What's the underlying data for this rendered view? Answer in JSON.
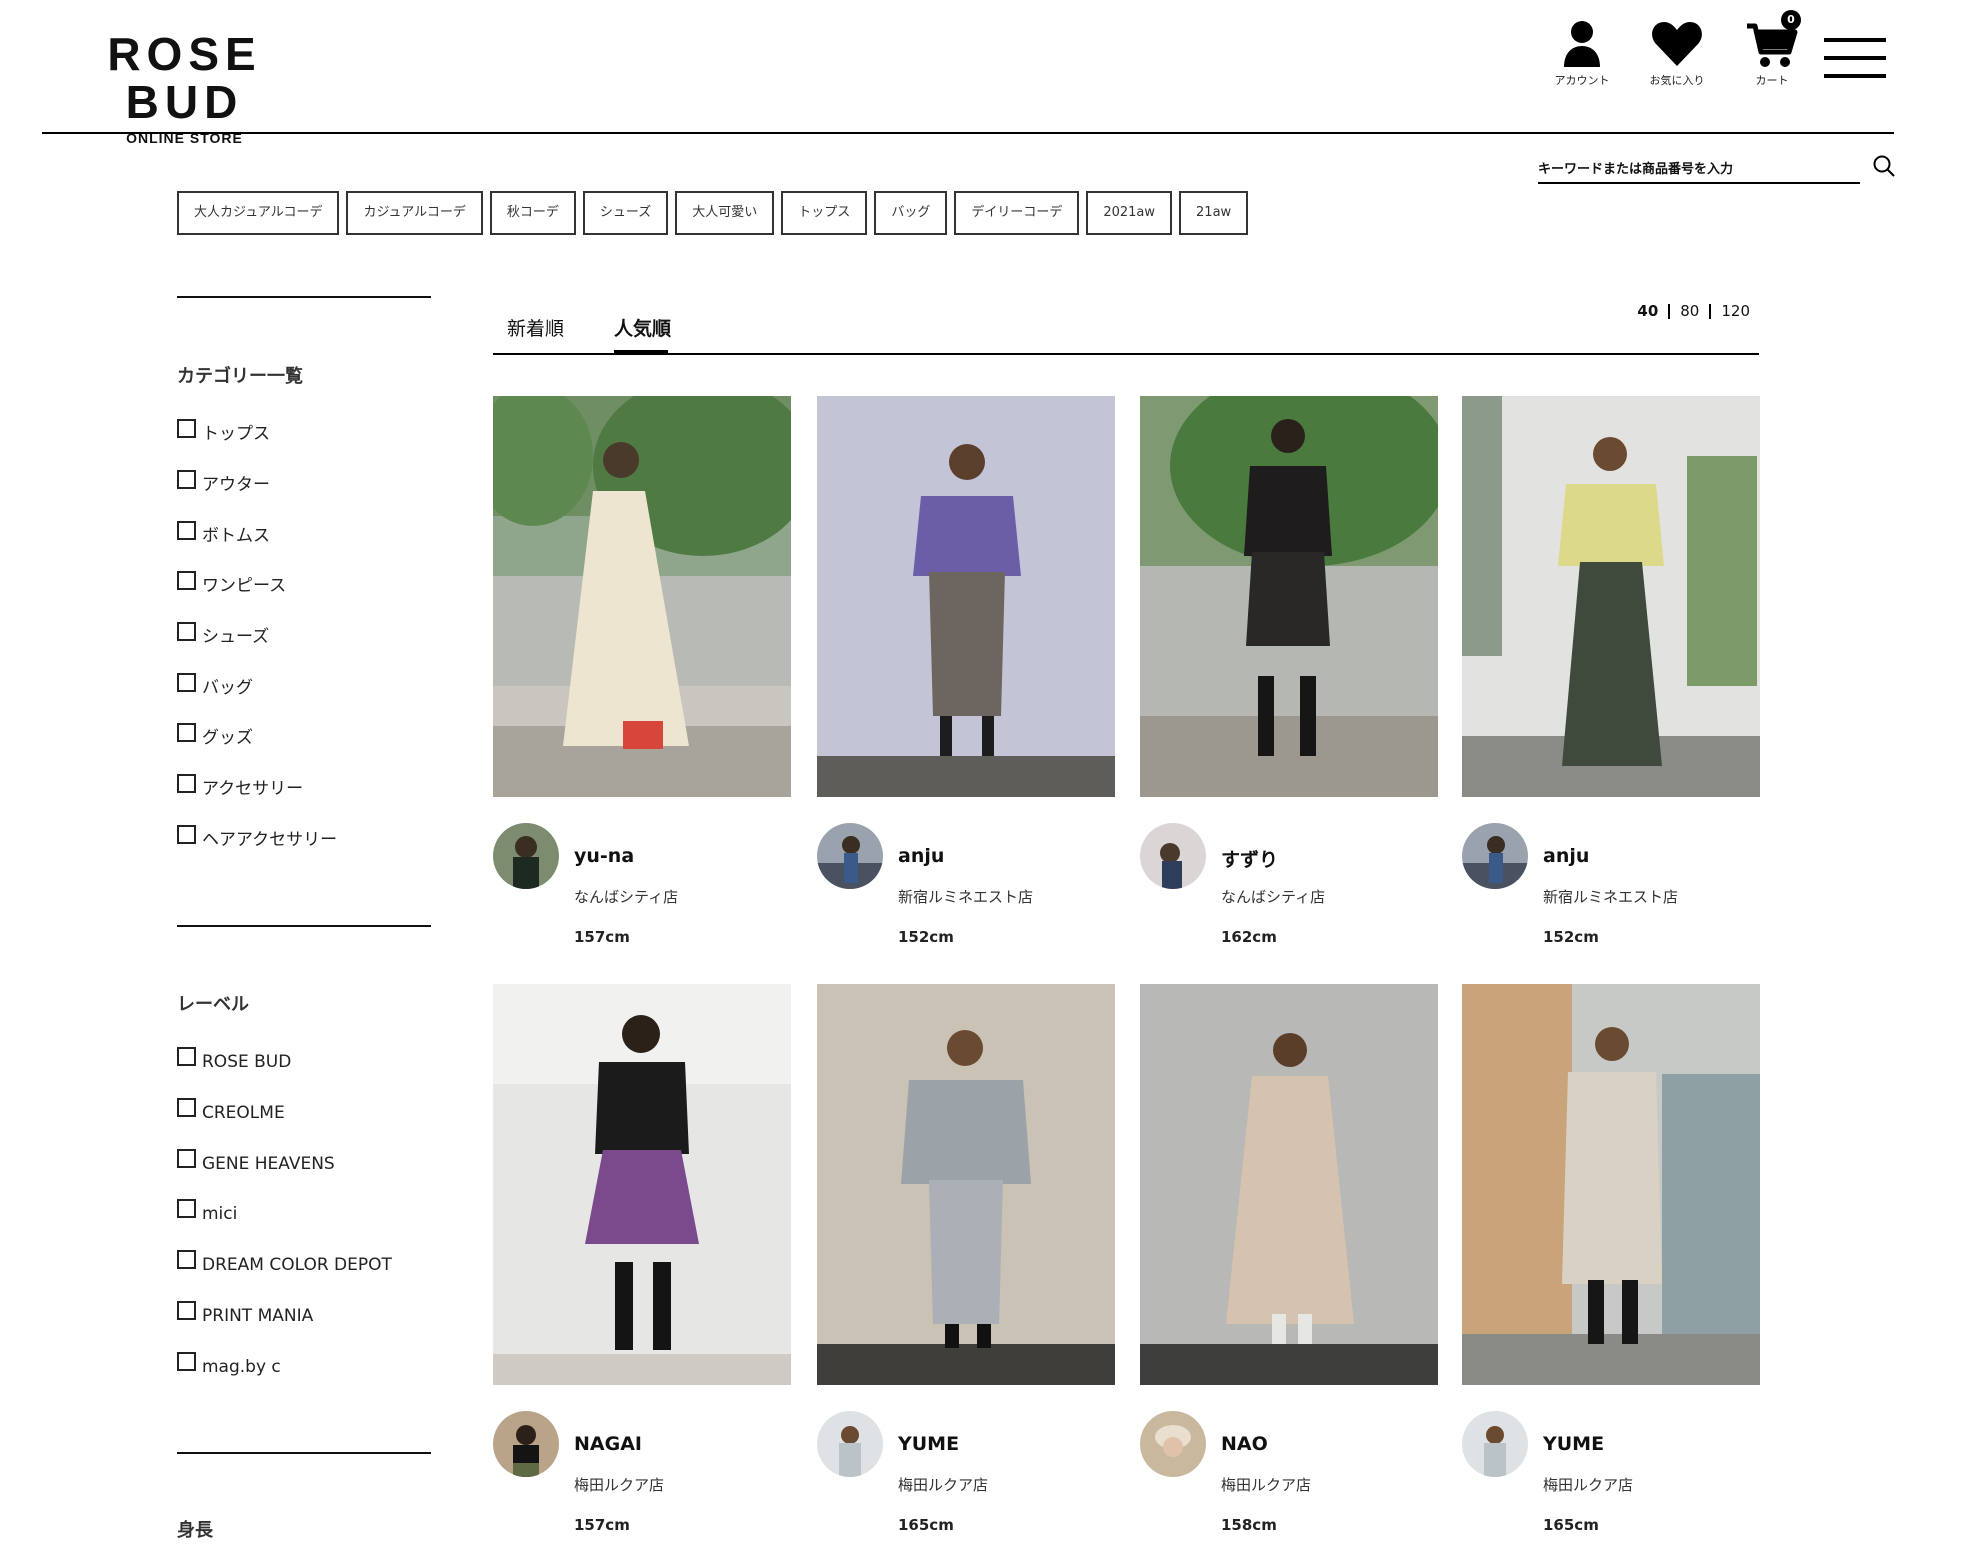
{
  "header": {
    "logo_main": "ROSE BUD",
    "logo_sub": "ONLINE STORE",
    "account_label": "アカウント",
    "favorite_label": "お気に入り",
    "cart_label": "カート",
    "cart_count": "0"
  },
  "search": {
    "placeholder": "キーワードまたは商品番号を入力"
  },
  "tags": [
    "大人カジュアルコーデ",
    "カジュアルコーデ",
    "秋コーデ",
    "シューズ",
    "大人可愛い",
    "トップス",
    "バッグ",
    "デイリーコーデ",
    "2021aw",
    "21aw"
  ],
  "sidebar": {
    "category_title": "カテゴリー一覧",
    "categories": [
      "トップス",
      "アウター",
      "ボトムス",
      "ワンピース",
      "シューズ",
      "バッグ",
      "グッズ",
      "アクセサリー",
      "ヘアアクセサリー"
    ],
    "label_title": "レーベル",
    "labels": [
      "ROSE BUD",
      "CREOLME",
      "GENE HEAVENS",
      "mici",
      "DREAM COLOR DEPOT",
      "PRINT MANIA",
      "mag.by c"
    ],
    "height_title": "身長"
  },
  "sort": {
    "tabs": [
      "新着順",
      "人気順"
    ],
    "active": "人気順"
  },
  "per_page": {
    "options": [
      "40",
      "80",
      "120"
    ],
    "active": "40"
  },
  "staff": [
    {
      "name": "yu-na",
      "shop": "なんばシティ店",
      "height": "157cm"
    },
    {
      "name": "anju",
      "shop": "新宿ルミネエスト店",
      "height": "152cm"
    },
    {
      "name": "すずり",
      "shop": "なんばシティ店",
      "height": "162cm"
    },
    {
      "name": "anju",
      "shop": "新宿ルミネエスト店",
      "height": "152cm"
    },
    {
      "name": "NAGAI",
      "shop": "梅田ルクア店",
      "height": "157cm"
    },
    {
      "name": "YUME",
      "shop": "梅田ルクア店",
      "height": "165cm"
    },
    {
      "name": "NAO",
      "shop": "梅田ルクア店",
      "height": "158cm"
    },
    {
      "name": "YUME",
      "shop": "梅田ルクア店",
      "height": "165cm"
    }
  ]
}
